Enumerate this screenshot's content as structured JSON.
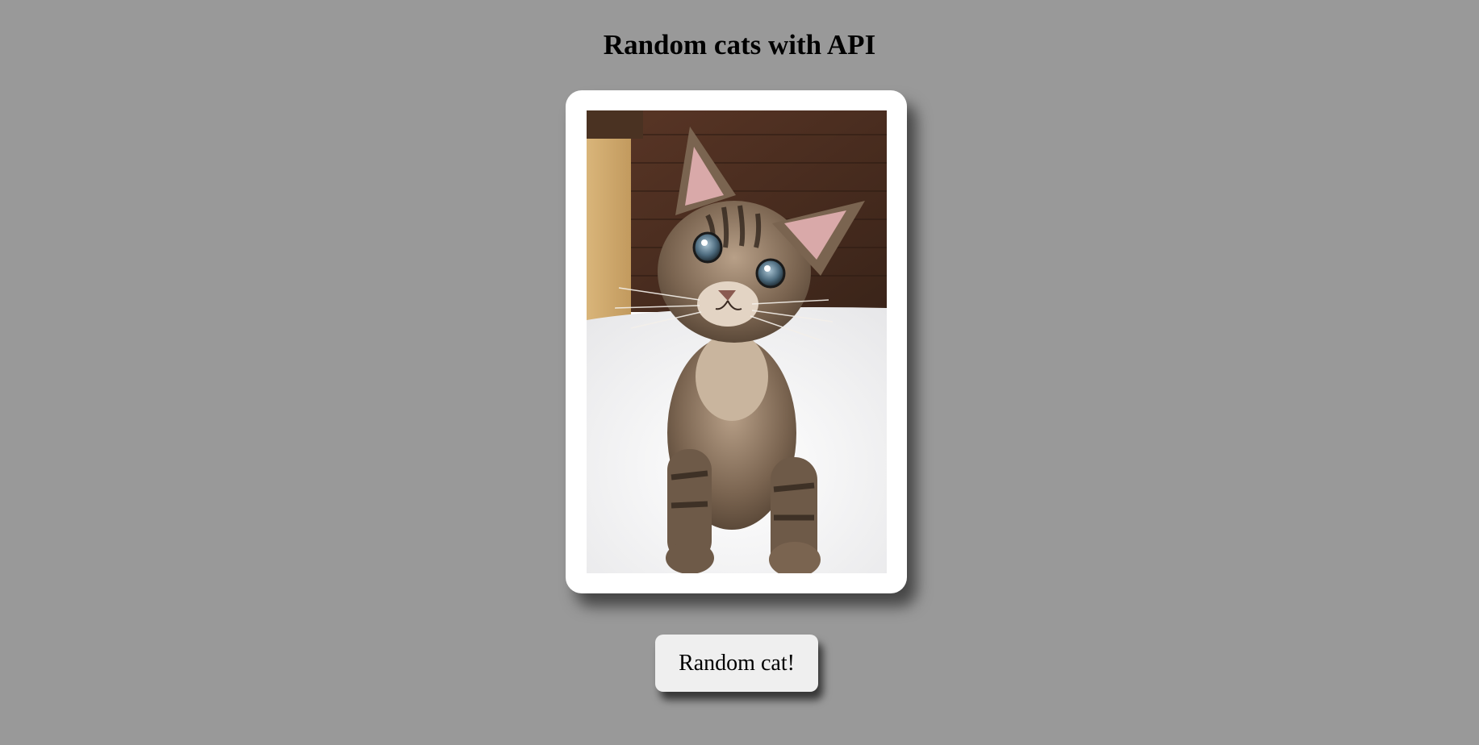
{
  "page": {
    "title": "Random cats with API",
    "background_color": "#999999"
  },
  "card": {
    "background_color": "#ffffff",
    "image_subject": "tabby kitten"
  },
  "button": {
    "label": "Random cat!",
    "background_color": "#efefef"
  }
}
